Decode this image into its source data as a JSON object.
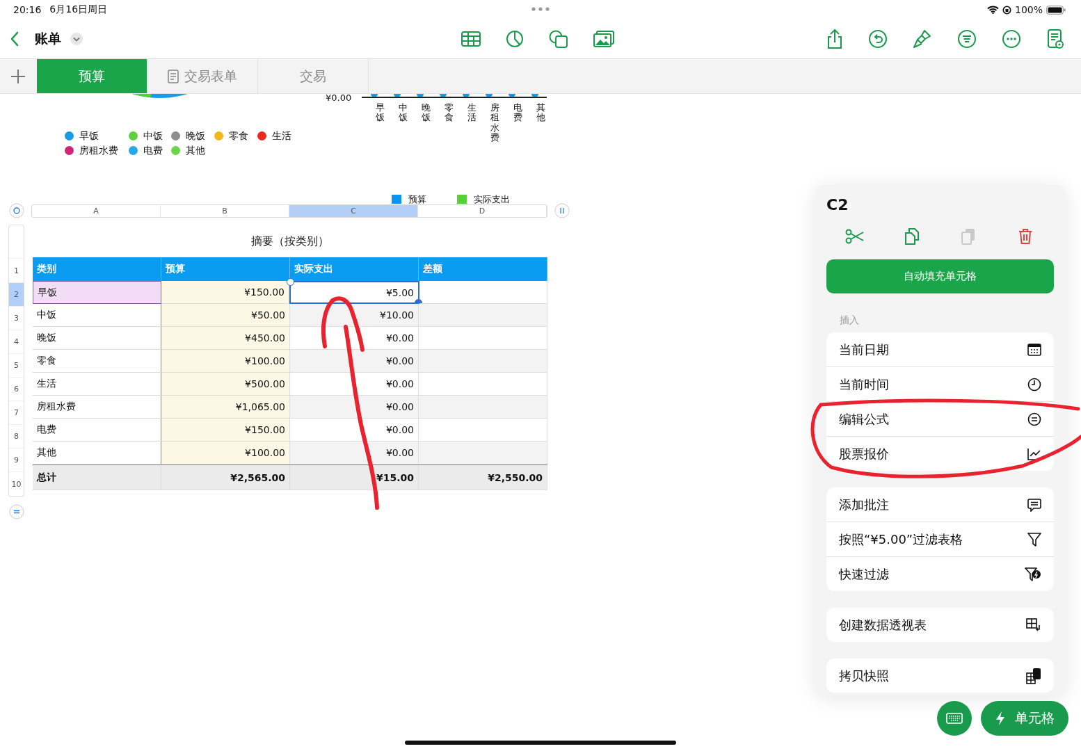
{
  "status_bar": {
    "time": "20:16",
    "date": "6月16日周日",
    "battery": "100%"
  },
  "toolbar": {
    "title": "账单"
  },
  "tabs": [
    {
      "label": "预算",
      "kind": "sheet",
      "selected": true
    },
    {
      "label": "交易表单",
      "kind": "form",
      "selected": false
    },
    {
      "label": "交易",
      "kind": "sheet",
      "selected": false
    }
  ],
  "pie_legend": [
    {
      "label": "早饭",
      "color": "#1a9be8"
    },
    {
      "label": "中饭",
      "color": "#5dd23c"
    },
    {
      "label": "晚饭",
      "color": "#8e8e8e"
    },
    {
      "label": "零食",
      "color": "#f2b71a"
    },
    {
      "label": "生活",
      "color": "#ea2a1a"
    },
    {
      "label": "房租水费",
      "color": "#d0267a"
    },
    {
      "label": "电费",
      "color": "#27a8e8"
    },
    {
      "label": "其他",
      "color": "#6ed54b"
    }
  ],
  "bar_chart": {
    "axis_label": "¥0.00",
    "categories": [
      "早饭",
      "中饭",
      "晚饭",
      "零食",
      "生活",
      "房租水费",
      "电费",
      "其他"
    ],
    "legend": [
      {
        "label": "预算",
        "color": "#0a96ee"
      },
      {
        "label": "实际支出",
        "color": "#55d23a"
      }
    ]
  },
  "table": {
    "title": "摘要（按类别）",
    "columns": [
      {
        "letter": "A",
        "header": "类别",
        "selected": false
      },
      {
        "letter": "B",
        "header": "预算",
        "selected": false
      },
      {
        "letter": "C",
        "header": "实际支出",
        "selected": true
      },
      {
        "letter": "D",
        "header": "差额",
        "selected": false
      }
    ],
    "header_row_number": "1",
    "rows": [
      {
        "number": "2",
        "category": "早饭",
        "budget": "¥150.00",
        "actual": "¥5.00",
        "selected": true,
        "highlighted": true
      },
      {
        "number": "3",
        "category": "中饭",
        "budget": "¥50.00",
        "actual": "¥10.00",
        "selected": false,
        "highlighted": false
      },
      {
        "number": "4",
        "category": "晚饭",
        "budget": "¥450.00",
        "actual": "¥0.00",
        "selected": false,
        "highlighted": false
      },
      {
        "number": "5",
        "category": "零食",
        "budget": "¥100.00",
        "actual": "¥0.00",
        "selected": false,
        "highlighted": false
      },
      {
        "number": "6",
        "category": "生活",
        "budget": "¥500.00",
        "actual": "¥0.00",
        "selected": false,
        "highlighted": false
      },
      {
        "number": "7",
        "category": "房租水费",
        "budget": "¥1,065.00",
        "actual": "¥0.00",
        "selected": false,
        "highlighted": false
      },
      {
        "number": "8",
        "category": "电费",
        "budget": "¥150.00",
        "actual": "¥0.00",
        "selected": false,
        "highlighted": false
      },
      {
        "number": "9",
        "category": "其他",
        "budget": "¥100.00",
        "actual": "¥0.00",
        "selected": false,
        "highlighted": false
      }
    ],
    "total": {
      "number": "10",
      "category": "总计",
      "budget": "¥2,565.00",
      "actual": "¥15.00",
      "difference": "¥2,550.00"
    }
  },
  "cell_menu": {
    "cell": "C2",
    "actions": [
      {
        "kind": "cut",
        "disabled": false
      },
      {
        "kind": "copy",
        "disabled": false
      },
      {
        "kind": "paste",
        "disabled": true
      },
      {
        "kind": "delete",
        "disabled": false
      }
    ],
    "primary_button": "自动填充单元格",
    "section_label": "插入",
    "groups": [
      [
        {
          "label": "当前日期",
          "kind": "calendar"
        },
        {
          "label": "当前时间",
          "kind": "clock"
        },
        {
          "label": "编辑公式",
          "kind": "equals"
        },
        {
          "label": "股票报价",
          "kind": "stock"
        }
      ],
      [
        {
          "label": "添加批注",
          "kind": "comment"
        },
        {
          "label": "按照“¥5.00”过滤表格",
          "kind": "filter"
        },
        {
          "label": "快速过滤",
          "kind": "quickfilter"
        }
      ],
      [
        {
          "label": "创建数据透视表",
          "kind": "pivot"
        }
      ],
      [
        {
          "label": "拷贝快照",
          "kind": "snapshot"
        }
      ]
    ]
  },
  "cell_button": "单元格"
}
